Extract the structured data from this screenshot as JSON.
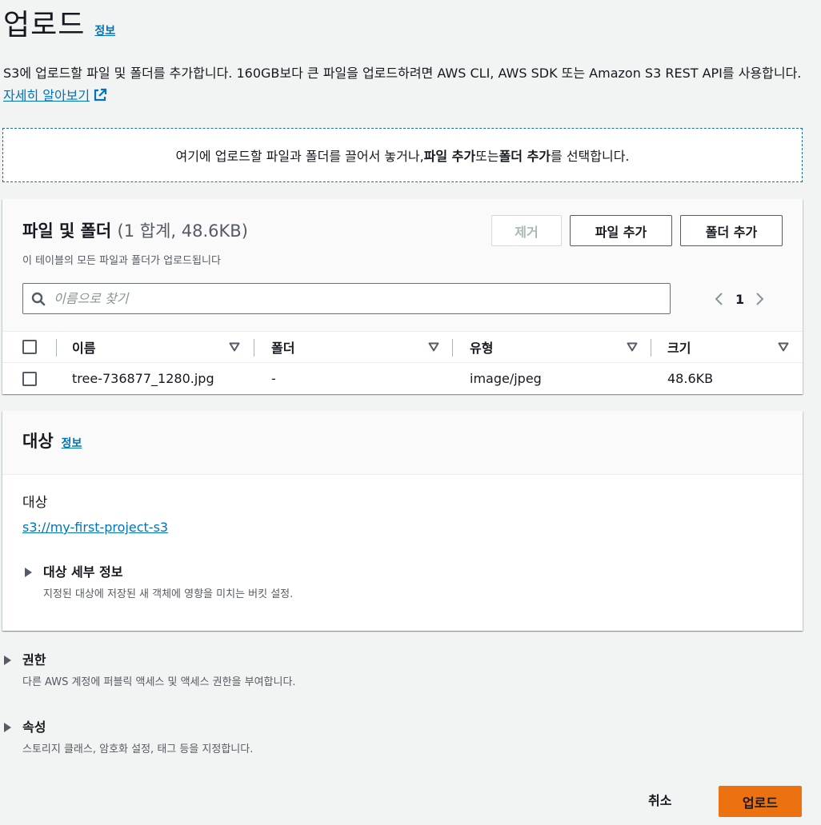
{
  "header": {
    "title": "업로드",
    "info": "정보",
    "description_text": "S3에 업로드할 파일 및 폴더를 추가합니다. 160GB보다 큰 파일을 업로드하려면 AWS CLI, AWS SDK 또는 Amazon S3 REST API를 사용합니다.",
    "learn_more": "자세히 알아보기"
  },
  "dropzone": {
    "prefix": "여기에 업로드할 파일과 폴더를 끌어서 놓거나, ",
    "add_files": "파일 추가",
    "middle": " 또는 ",
    "add_folder": "폴더 추가",
    "suffix": "를 선택합니다."
  },
  "files_panel": {
    "title": "파일 및 폴더",
    "count": "(1 합계, 48.6KB)",
    "subtitle": "이 테이블의 모든 파일과 폴더가 업로드됩니다",
    "remove_button": "제거",
    "add_files_button": "파일 추가",
    "add_folder_button": "폴더 추가",
    "search_placeholder": "이름으로 찾기",
    "page": "1",
    "columns": [
      "이름",
      "폴더",
      "유형",
      "크기"
    ],
    "rows": [
      {
        "name": "tree-736877_1280.jpg",
        "folder": "-",
        "type": "image/jpeg",
        "size": "48.6KB"
      }
    ]
  },
  "destination_panel": {
    "title": "대상",
    "info": "정보",
    "label": "대상",
    "value": "s3://my-first-project-s3",
    "details_title": "대상 세부 정보",
    "details_desc": "지정된 대상에 저장된 새 객체에 영향을 미치는 버킷 설정."
  },
  "permissions": {
    "title": "권한",
    "desc": "다른 AWS 계정에 퍼블릭 액세스 및 액세스 권한을 부여합니다."
  },
  "properties": {
    "title": "속성",
    "desc": "스토리지 클래스, 암호화 설정, 태그 등을 지정합니다."
  },
  "footer": {
    "cancel": "취소",
    "upload": "업로드"
  },
  "colors": {
    "link": "#0073bb",
    "primary_button": "#ec7211",
    "background": "#f2f3f3"
  }
}
